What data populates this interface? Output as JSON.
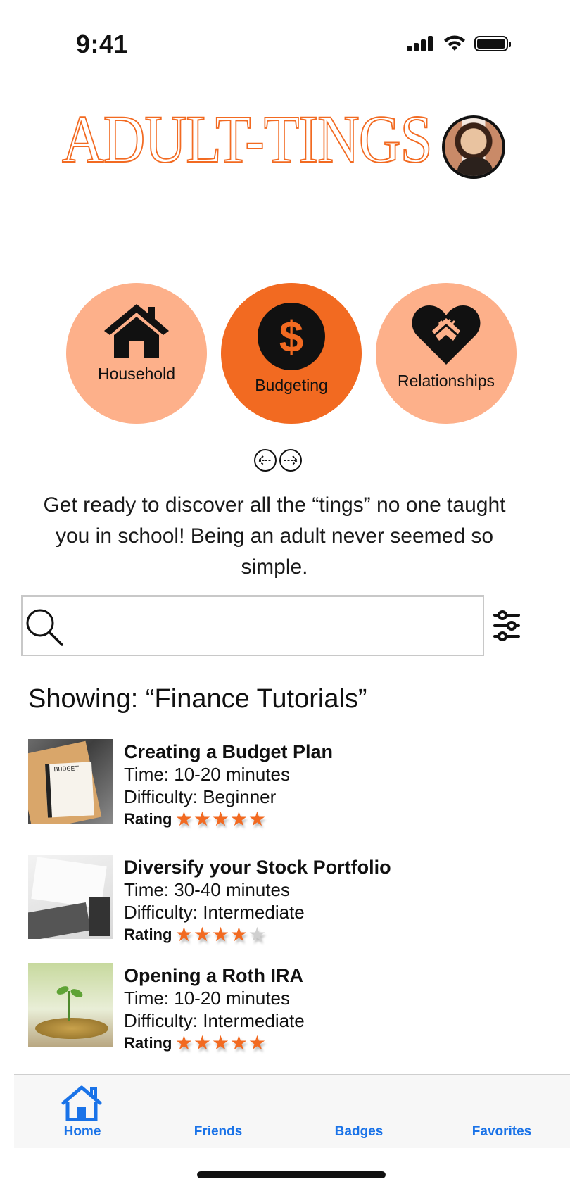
{
  "status_bar": {
    "time": "9:41"
  },
  "header": {
    "title": "ADULT-TINGS"
  },
  "categories": [
    {
      "label": "Household",
      "icon": "house-icon",
      "active": false
    },
    {
      "label": "Budgeting",
      "icon": "dollar-icon",
      "active": true
    },
    {
      "label": "Relationships",
      "icon": "heart-handshake-icon",
      "active": false
    }
  ],
  "intro": "Get ready to discover all the “tings” no one taught you in school! Being an adult never seemed so simple.",
  "search": {
    "placeholder": "",
    "value": ""
  },
  "results": {
    "showing": "Showing: “Finance Tutorials”",
    "tutorials": [
      {
        "title": "Creating a Budget Plan",
        "time": "Time: 10-20 minutes",
        "difficulty": "Difficulty: Beginner",
        "rating_label": "Rating",
        "rating": 5
      },
      {
        "title": "Diversify your Stock Portfolio",
        "time": "Time: 30-40 minutes",
        "difficulty": "Difficulty: Intermediate",
        "rating_label": "Rating",
        "rating": 4
      },
      {
        "title": "Opening a Roth IRA",
        "time": "Time: 10-20 minutes",
        "difficulty": "Difficulty: Intermediate",
        "rating_label": "Rating",
        "rating": 5
      }
    ],
    "thumb_texts": {
      "budget": "BUDGET"
    }
  },
  "tabs": [
    {
      "label": "Home",
      "active": true
    },
    {
      "label": "Friends",
      "active": false
    },
    {
      "label": "Badges",
      "active": false
    },
    {
      "label": "Favorites",
      "active": false
    }
  ],
  "colors": {
    "accent": "#f26a21",
    "accent_light": "#fdb08a",
    "tab_blue": "#1a73e8",
    "star_off": "#cfcfcf"
  }
}
